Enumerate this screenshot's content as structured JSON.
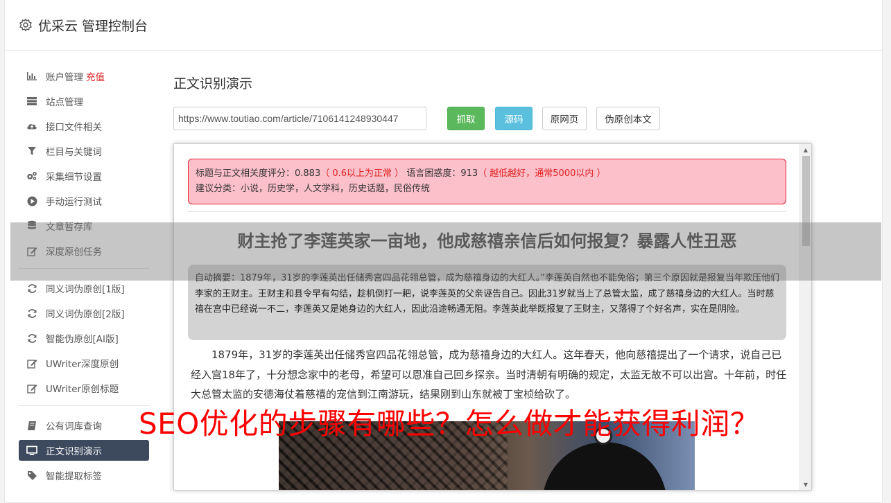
{
  "app": {
    "title": "优采云 管理控制台"
  },
  "sidebar": {
    "group1": [
      {
        "label": "账户管理",
        "badge": "充值",
        "icon": "bar-chart-icon"
      },
      {
        "label": "站点管理",
        "icon": "server-icon"
      },
      {
        "label": "接口文件相关",
        "icon": "cloud-upload-icon"
      },
      {
        "label": "栏目与关键词",
        "icon": "filter-icon"
      },
      {
        "label": "采集细节设置",
        "icon": "gears-icon"
      },
      {
        "label": "手动运行测试",
        "icon": "play-icon"
      },
      {
        "label": "文章暂存库",
        "icon": "database-icon"
      },
      {
        "label": "深度原创任务",
        "icon": "edit-icon"
      }
    ],
    "group2": [
      {
        "label": "同义词伪原创[1版]",
        "icon": "refresh-icon"
      },
      {
        "label": "同义词伪原创[2版]",
        "icon": "refresh-icon"
      },
      {
        "label": "智能伪原创[AI版]",
        "icon": "refresh-icon"
      },
      {
        "label": "UWriter深度原创",
        "icon": "edit-icon"
      },
      {
        "label": "UWriter原创标题",
        "icon": "edit-icon"
      }
    ],
    "group3": [
      {
        "label": "公有词库查询",
        "icon": "book-icon"
      },
      {
        "label": "正文识别演示",
        "icon": "monitor-icon",
        "active": true
      },
      {
        "label": "智能提取标签",
        "icon": "tag-icon"
      }
    ]
  },
  "main": {
    "page_title": "正文识别演示",
    "url_value": "https://www.toutiao.com/article/7106141248930447",
    "buttons": {
      "fetch": "抓取",
      "source": "源码",
      "original_page": "原网页",
      "rewrite": "伪原创本文"
    }
  },
  "result": {
    "score_label": "标题与正文相关度评分：0.883",
    "score_note": "（ 0.6以上为正常 ）",
    "perplexity_label": "语言困惑度：913",
    "perplexity_note": "（ 越低越好，通常5000以内 ）",
    "category": "建议分类：小说，历史学，人文学科，历史话题，民俗传统",
    "article_title": "财主抢了李莲英家一亩地，他成慈禧亲信后如何报复？暴露人性丑恶",
    "summary": "自动摘要：1879年，31岁的李莲英出任储秀宫四品花翎总管，成为慈禧身边的大红人。”李莲英自然也不能免俗；第三个原因就是报复当年欺压他们李家的王财主。王财主和县令早有勾结，趁机倒打一耙，说李莲英的父亲诬告自己。因此31岁就当上了总管太监，成了慈禧身边的大红人。当时慈禧在宫中已经说一不二，李莲英又是她身边的大红人，因此沿途畅通无阻。李莲英此举既报复了王财主，又落得了个好名声，实在是阴险。",
    "body": "1879年，31岁的李莲英出任储秀宫四品花翎总管，成为慈禧身边的大红人。这年春天，他向慈禧提出了一个请求，说自己已经入宫18年了，十分想念家中的老母，希望可以恩准自己回乡探亲。当时清朝有明确的规定，太监无故不可以出宫。十年前，时任大总管太监的安德海仗着慈禧的宠信到江南游玩，结果刚到山东就被丁宝桢给砍了。"
  },
  "watermark": "SEO优化的步骤有哪些？怎么做才能获得利润？",
  "colors": {
    "active_nav": "#3d4a5e",
    "fetch_button": "#5cb85c",
    "source_button": "#5bc0de",
    "score_bg": "#fcc0cb",
    "score_border": "#e2202f",
    "watermark": "#ff0000"
  }
}
